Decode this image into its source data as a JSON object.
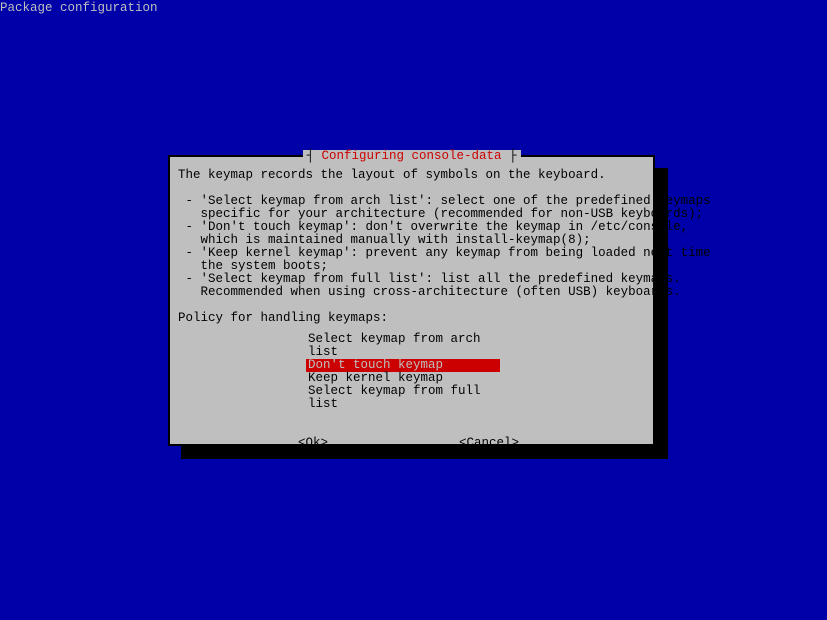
{
  "header": {
    "title": "Package configuration"
  },
  "dialog": {
    "title": "Configuring console-data",
    "description": "The keymap records the layout of symbols on the keyboard.\n\n - 'Select keymap from arch list': select one of the predefined keymaps\n   specific for your architecture (recommended for non-USB keyboards);\n - 'Don't touch keymap': don't overwrite the keymap in /etc/console,\n   which is maintained manually with install-keymap(8);\n - 'Keep kernel keymap': prevent any keymap from being loaded next time\n   the system boots;\n - 'Select keymap from full list': list all the predefined keymaps.\n   Recommended when using cross-architecture (often USB) keyboards.\n\nPolicy for handling keymaps:",
    "options": [
      {
        "label": "Select keymap from arch list",
        "selected": false
      },
      {
        "label": "Don't touch keymap",
        "selected": true
      },
      {
        "label": "Keep kernel keymap",
        "selected": false
      },
      {
        "label": "Select keymap from full list",
        "selected": false
      }
    ],
    "buttons": {
      "ok": "<Ok>",
      "cancel": "<Cancel>"
    }
  }
}
